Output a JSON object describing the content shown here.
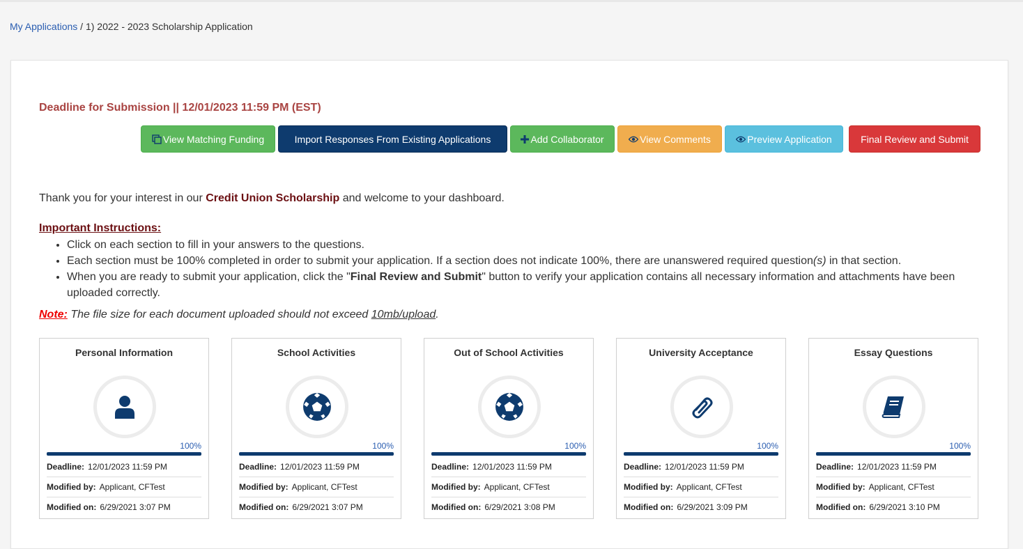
{
  "breadcrumb": {
    "link": "My Applications",
    "separator": " / ",
    "current": "1) 2022 - 2023 Scholarship Application"
  },
  "deadline": "Deadline for Submission || 12/01/2023 11:59 PM (EST)",
  "buttons": {
    "view_matching": "View Matching Funding",
    "import_responses": "Import Responses From Existing Applications",
    "add_collaborator": "Add Collaborator",
    "view_comments": "View Comments",
    "preview": "Preview Application",
    "final_review": "Final Review and Submit"
  },
  "intro": {
    "before": "Thank you for your interest in our ",
    "scholarship": "Credit Union Scholarship",
    "after": " and welcome to your dashboard."
  },
  "instructions": {
    "title": "Important Instructions:",
    "item1": "Click on each section to fill in your answers to the questions.",
    "item2_a": "Each section must be 100% completed in order to submit your application. If a section does not indicate 100%, there are unanswered required question",
    "item2_b": "(s)",
    "item2_c": " in that section.",
    "item3_a": "When you are ready to submit your application, click the \"",
    "item3_b": "Final Review and Submit",
    "item3_c": "\" button to verify your application contains all necessary information and attachments have been uploaded correctly."
  },
  "note": {
    "label": "Note:",
    "text": " The file size for each document uploaded should not exceed ",
    "size": "10mb/upload",
    "end": "."
  },
  "meta_labels": {
    "deadline": "Deadline:",
    "modified_by": "Modified by:",
    "modified_on": "Modified on:"
  },
  "colors": {
    "accent": "#0e3b6e",
    "deadline": "#a94442",
    "link": "#2a5db0"
  },
  "sections": [
    {
      "title": "Personal Information",
      "icon": "user-icon",
      "progress": 100,
      "percent": "100%",
      "deadline": "12/01/2023 11:59 PM",
      "modified_by": "Applicant, CFTest",
      "modified_on": "6/29/2021 3:07 PM"
    },
    {
      "title": "School Activities",
      "icon": "soccer-ball-icon",
      "progress": 100,
      "percent": "100%",
      "deadline": "12/01/2023 11:59 PM",
      "modified_by": "Applicant, CFTest",
      "modified_on": "6/29/2021 3:07 PM"
    },
    {
      "title": "Out of School Activities",
      "icon": "soccer-ball-icon",
      "progress": 100,
      "percent": "100%",
      "deadline": "12/01/2023 11:59 PM",
      "modified_by": "Applicant, CFTest",
      "modified_on": "6/29/2021 3:08 PM"
    },
    {
      "title": "University Acceptance",
      "icon": "paperclip-icon",
      "progress": 100,
      "percent": "100%",
      "deadline": "12/01/2023 11:59 PM",
      "modified_by": "Applicant, CFTest",
      "modified_on": "6/29/2021 3:09 PM"
    },
    {
      "title": "Essay Questions",
      "icon": "book-icon",
      "progress": 100,
      "percent": "100%",
      "deadline": "12/01/2023 11:59 PM",
      "modified_by": "Applicant, CFTest",
      "modified_on": "6/29/2021 3:10 PM"
    }
  ]
}
